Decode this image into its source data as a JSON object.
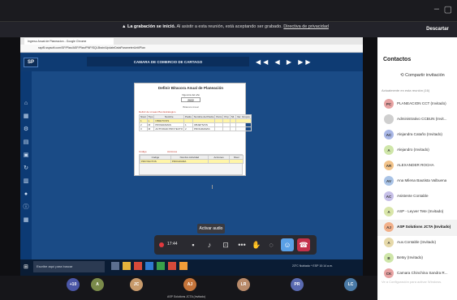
{
  "window": {
    "min_icon": "minimize-icon",
    "max_icon": "maximize-icon"
  },
  "banner": {
    "icon": "warning-icon",
    "bold": "La grabación se inició.",
    "text": "Al asistir a esta reunión, está aceptando ser grabado.",
    "link": "Directiva de privacidad",
    "dismiss": "Descartar"
  },
  "shared_screen": {
    "browser_tab": "Ingreso Anual de Planeacion - Google Chrome",
    "url": "sspf5.sspsoft.com/SP/Plan/ASP/Plan/PNP/SQLBrain/UpdateDataParameterUntilPlan",
    "app_logo": "SP",
    "app_title": "CAMARA DE COMERCIO DE CARTAGO",
    "nav_arrows": "◀◀ ◀ ▶ ▶▶",
    "panel": {
      "title": "Definir Bitacora Anual de Planeación",
      "year_label": "Vigencia del año",
      "year": "2022",
      "sublabel": "Bitácora Anual",
      "section1": "Definir de Líneas Plan Estratégico",
      "table1_headers": [
        "Nivel",
        "Tipo",
        "Nombre",
        "Padre",
        "Nombre del Padre",
        "Perio",
        "Pnp",
        "Sil.",
        "Ver. Grupos"
      ],
      "table1_rows": [
        [
          "1",
          "L",
          "OBJETIVOS",
          "",
          "",
          "",
          "",
          "",
          ""
        ],
        [
          "2",
          "M",
          "PROGRAMAS",
          "1",
          "OBJETIVOS",
          "",
          "",
          "",
          ""
        ],
        [
          "3",
          "M",
          "ACTIVIDAD PROYECTO",
          "2",
          "PROGRAMAS",
          "",
          "",
          "",
          ""
        ]
      ],
      "section2": "Código",
      "actions2": "Acciones",
      "table2_headers": [
        "Código",
        "Nombre Actividad",
        "Acciones",
        "Nivel"
      ],
      "table2_rows": [
        [
          "PROYECTOS",
          "PROGRAMA",
          "",
          ""
        ]
      ]
    },
    "taskbar": {
      "search": "Escribe aquí para buscar",
      "tray": "23°C Nublado  ^  ESP  10:14 a.m."
    }
  },
  "controls": {
    "tooltip": "Activar audio",
    "timer": "17:44",
    "icons": [
      "video-off-icon",
      "mic-off-icon",
      "share-screen-icon",
      "more-icon",
      "raise-hand-icon",
      "chat-icon",
      "participants-icon",
      "hangup-icon"
    ]
  },
  "sidebar": {
    "title": "Contactos",
    "invite": "Compartir invitación",
    "meta": "Actualmente en esta reunión (16)",
    "participants": [
      {
        "initials": "PC",
        "name": "PLANEACION CCT (Invitado)",
        "color": "#e8a3a3"
      },
      {
        "initials": "",
        "name": "Administrativo CCBUN (Invit...",
        "color": "#cfcfcf"
      },
      {
        "initials": "AC",
        "name": "Alejandra Cataño (Invitado)",
        "color": "#a9b7e6"
      },
      {
        "initials": "A",
        "name": "Alejandro (Invitado)",
        "color": "#cfe6a9"
      },
      {
        "initials": "AR",
        "name": "ALEXANDER ROCHA",
        "color": "#f2c38a"
      },
      {
        "initials": "AV",
        "name": "Ana Milena Bautista Valbuena",
        "color": "#a9c3e6"
      },
      {
        "initials": "AC",
        "name": "Asistente Contable",
        "color": "#c7c0e8"
      },
      {
        "initials": "A",
        "name": "ASP - Leyver Tete (Invitado)",
        "color": "#d9e6a9"
      },
      {
        "initials": "AJ",
        "name": "ASP Solutions JCTA (Invitado)",
        "color": "#f2b08a"
      },
      {
        "initials": "A",
        "name": "Aux.Contable (Invitado)",
        "color": "#e6d9a9"
      },
      {
        "initials": "B",
        "name": "Betsy (Invitado)",
        "color": "#cfe6a9"
      },
      {
        "initials": "CK",
        "name": "Camara Chinchina Sandra R...",
        "color": "#e8a3a3"
      }
    ],
    "footer": "Ve a Configuración para activar Windows."
  },
  "bottom_strip": {
    "participants": [
      {
        "initials": "+10",
        "name": "",
        "color": "#4a56a6"
      },
      {
        "initials": "A",
        "name": "",
        "color": "#7a8a4a"
      },
      {
        "initials": "JC",
        "name": "",
        "color": "#c79a6b"
      },
      {
        "initials": "AJ",
        "name": "ASP Solutions JCTA (Invitado)",
        "color": "#c4743a"
      },
      {
        "initials": "LR",
        "name": "",
        "color": "#b88a6a"
      },
      {
        "initials": "PR",
        "name": "",
        "color": "#5a6ab0"
      },
      {
        "initials": "LC",
        "name": "",
        "color": "#4a7aa6"
      }
    ]
  },
  "colors": {
    "accent": "#5aa0e6",
    "danger": "#c4314b",
    "app_blue": "#1a4b86"
  }
}
